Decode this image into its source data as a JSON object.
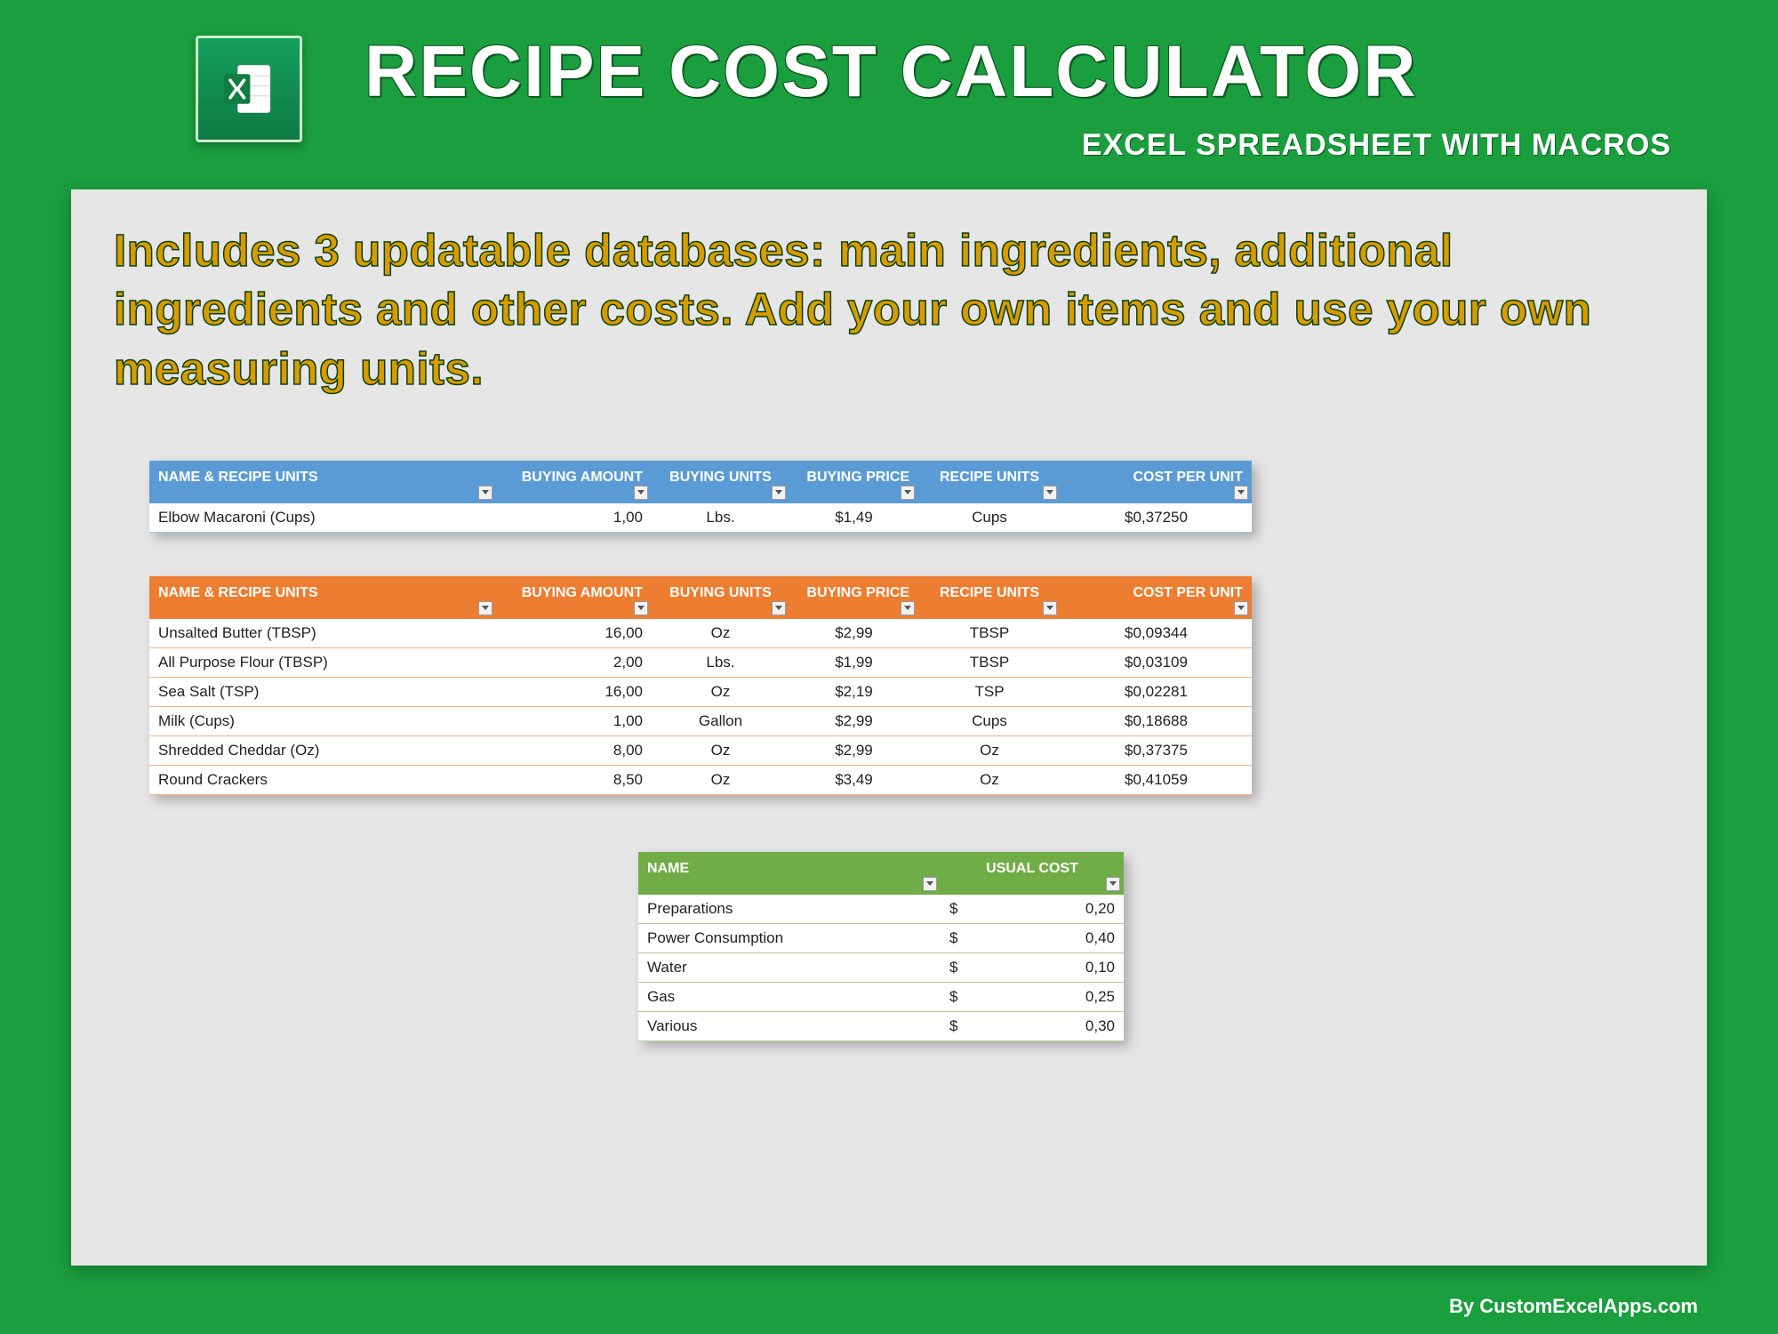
{
  "header": {
    "title": "RECIPE COST CALCULATOR",
    "subtitle": "EXCEL SPREADSHEET WITH MACROS"
  },
  "description": "Includes 3 updatable databases: main ingredients, additional ingredients and other costs. Add your own items and use your own measuring units.",
  "tables": {
    "columns6": {
      "name": "NAME & RECIPE UNITS",
      "buying_amount": "BUYING AMOUNT",
      "buying_units": "BUYING UNITS",
      "buying_price": "BUYING PRICE",
      "recipe_units": "RECIPE UNITS",
      "cost_per_unit": "COST PER UNIT"
    },
    "blue_rows": [
      {
        "name": "Elbow Macaroni (Cups)",
        "amount": "1,00",
        "bunits": "Lbs.",
        "price": "$1,49",
        "runits": "Cups",
        "cpu": "$0,37250"
      }
    ],
    "orange_rows": [
      {
        "name": "Unsalted Butter (TBSP)",
        "amount": "16,00",
        "bunits": "Oz",
        "price": "$2,99",
        "runits": "TBSP",
        "cpu": "$0,09344"
      },
      {
        "name": "All Purpose Flour (TBSP)",
        "amount": "2,00",
        "bunits": "Lbs.",
        "price": "$1,99",
        "runits": "TBSP",
        "cpu": "$0,03109"
      },
      {
        "name": "Sea Salt (TSP)",
        "amount": "16,00",
        "bunits": "Oz",
        "price": "$2,19",
        "runits": "TSP",
        "cpu": "$0,02281"
      },
      {
        "name": "Milk (Cups)",
        "amount": "1,00",
        "bunits": "Gallon",
        "price": "$2,99",
        "runits": "Cups",
        "cpu": "$0,18688"
      },
      {
        "name": "Shredded Cheddar (Oz)",
        "amount": "8,00",
        "bunits": "Oz",
        "price": "$2,99",
        "runits": "Oz",
        "cpu": "$0,37375"
      },
      {
        "name": "Round Crackers",
        "amount": "8,50",
        "bunits": "Oz",
        "price": "$3,49",
        "runits": "Oz",
        "cpu": "$0,41059"
      }
    ],
    "green_headers": {
      "name": "NAME",
      "cost": "USUAL COST"
    },
    "green_rows": [
      {
        "name": "Preparations",
        "sym": "$",
        "val": "0,20"
      },
      {
        "name": "Power Consumption",
        "sym": "$",
        "val": "0,40"
      },
      {
        "name": "Water",
        "sym": "$",
        "val": "0,10"
      },
      {
        "name": "Gas",
        "sym": "$",
        "val": "0,25"
      },
      {
        "name": "Various",
        "sym": "$",
        "val": "0,30"
      }
    ]
  },
  "footer": "By CustomExcelApps.com"
}
